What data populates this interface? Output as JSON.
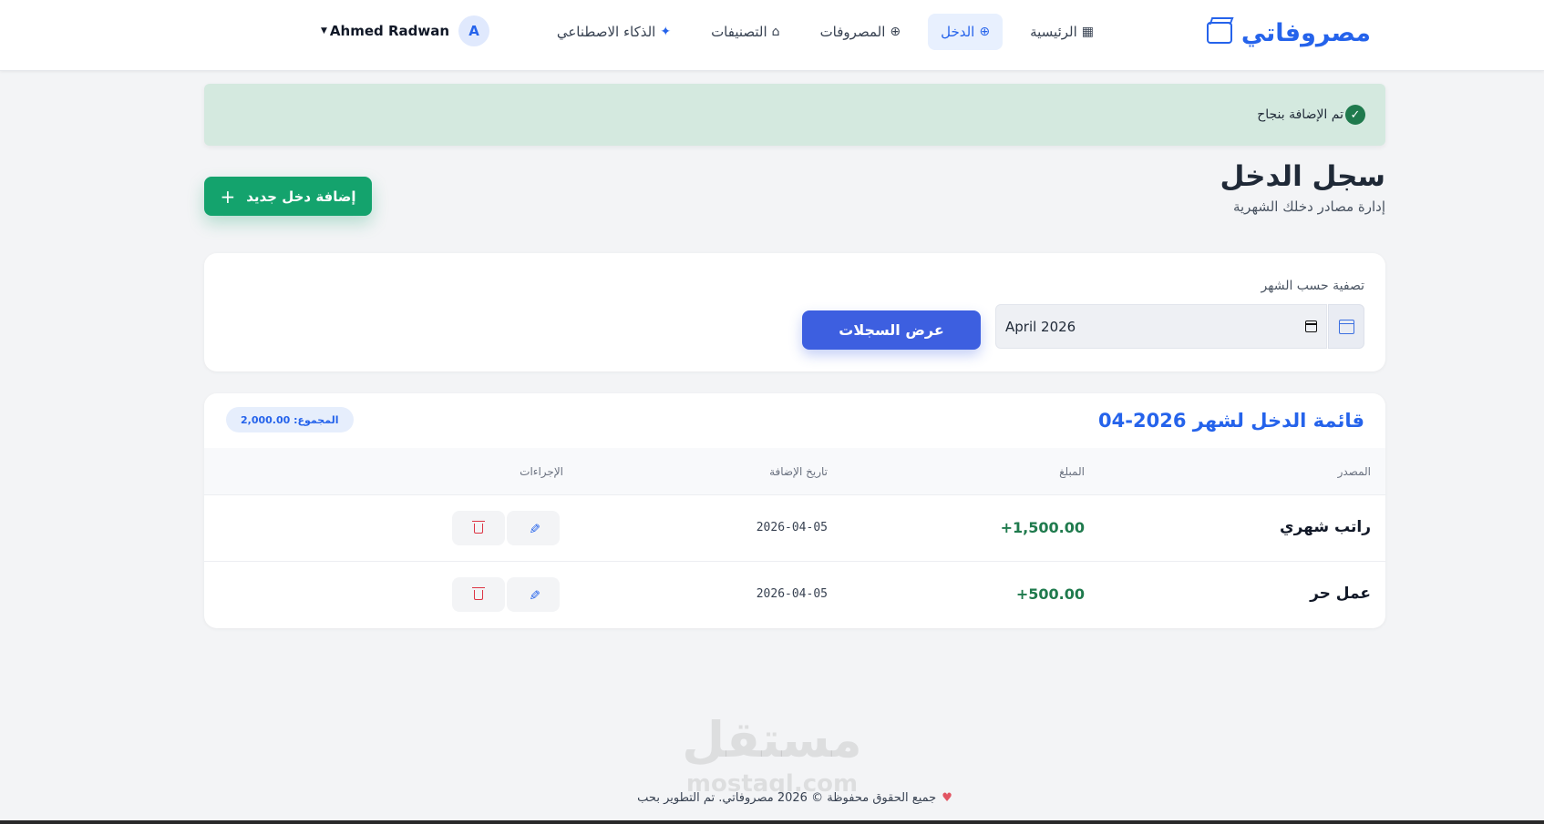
{
  "brand": {
    "name": "مصروفاتي"
  },
  "nav": {
    "items": [
      {
        "label": "الرئيسية",
        "icon": "▦",
        "active": false
      },
      {
        "label": "الدخل",
        "icon": "⊕",
        "active": true
      },
      {
        "label": "المصروفات",
        "icon": "⊕",
        "active": false
      },
      {
        "label": "التصنيفات",
        "icon": "⌂",
        "active": false
      },
      {
        "label": "الذكاء الاصطناعي",
        "icon": "✦",
        "active": false
      }
    ]
  },
  "user": {
    "name": "Ahmed Radwan",
    "initial": "A"
  },
  "alert": {
    "text": "تم الإضافة بنجاح",
    "icon": "✓"
  },
  "header": {
    "title": "سجل الدخل",
    "subtitle": "إدارة مصادر دخلك الشهرية",
    "add_label": "إضافة دخل جديد",
    "add_icon": "+"
  },
  "filter": {
    "label": "تصفية حسب الشهر",
    "month_value": "April 2026",
    "button_label": "عرض السجلات"
  },
  "list": {
    "title": "قائمة الدخل لشهر 2026-04",
    "total": "المجموع: 2,000.00",
    "columns": {
      "source": "المصدر",
      "amount": "المبلغ",
      "date": "تاريخ الإضافة",
      "actions": "الإجراءات"
    },
    "rows": [
      {
        "source": "راتب شهري",
        "amount": "+1,500.00",
        "date": "2026-04-05"
      },
      {
        "source": "عمل حر",
        "amount": "+500.00",
        "date": "2026-04-05"
      }
    ]
  },
  "footer": {
    "watermark": "مستقل",
    "watermark_sub": "mostaql.com",
    "text": "جميع الحقوق محفوظة © 2026 مصروفاتي. تم التطوير بحب",
    "heart": "♥"
  },
  "colors": {
    "primary": "#2563eb",
    "success": "#14a36d",
    "danger": "#dc3545",
    "alert_bg": "#d4e9df"
  }
}
